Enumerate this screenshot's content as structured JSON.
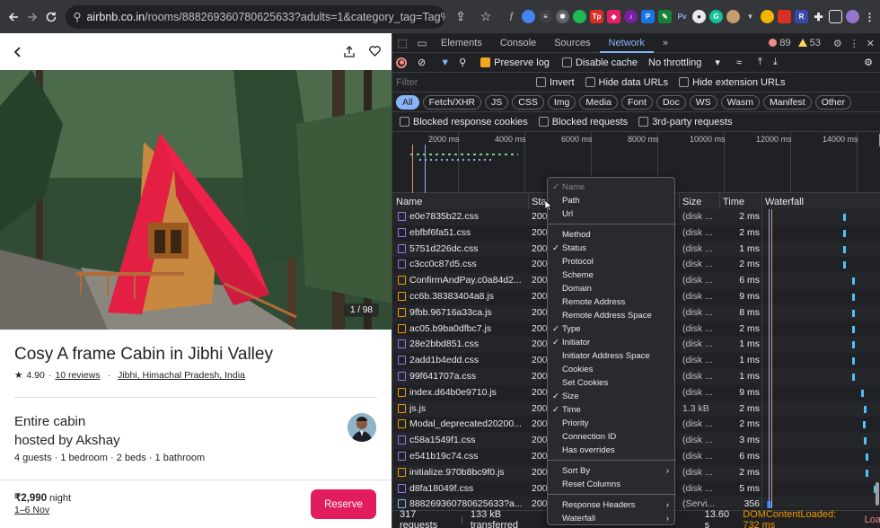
{
  "browser": {
    "url_host": "airbnb.co.in",
    "url_path": "/rooms/888269360780625633?adults=1&category_tag=Tag%3A818..."
  },
  "listing": {
    "photo_counter": "1 / 98",
    "title": "Cosy A frame Cabin in Jibhi Valley",
    "rating": "4.90",
    "reviews": "10 reviews",
    "dot": "·",
    "location": "Jibhi, Himachal Pradesh, India",
    "host_line1": "Entire cabin",
    "host_line2": "hosted by Akshay",
    "facts": "4 guests · 1 bedroom · 2 beds · 1 bathroom",
    "price": "₹2,990",
    "price_unit": "night",
    "dates": "1–6 Nov",
    "reserve_label": "Reserve"
  },
  "devtools": {
    "tabs": [
      "Elements",
      "Console",
      "Sources",
      "Network"
    ],
    "active_tab": "Network",
    "more_tabs": "»",
    "errors": "89",
    "warnings": "53",
    "toolbar": {
      "preserve_log": "Preserve log",
      "disable_cache": "Disable cache",
      "throttling": "No throttling"
    },
    "filter": {
      "placeholder": "Filter",
      "invert": "Invert",
      "hide_data_urls": "Hide data URLs",
      "hide_extension_urls": "Hide extension URLs"
    },
    "type_filters": [
      "All",
      "Fetch/XHR",
      "JS",
      "CSS",
      "Img",
      "Media",
      "Font",
      "Doc",
      "WS",
      "Wasm",
      "Manifest",
      "Other"
    ],
    "blocked": {
      "blocked_cookies": "Blocked response cookies",
      "blocked_requests": "Blocked requests",
      "third_party": "3rd-party requests"
    },
    "timeline_ticks": [
      "2000 ms",
      "4000 ms",
      "6000 ms",
      "8000 ms",
      "10000 ms",
      "12000 ms",
      "14000 ms"
    ],
    "columns": {
      "name": "Name",
      "status": "Sta",
      "size": "Size",
      "time": "Time",
      "waterfall": "Waterfall"
    },
    "rows": [
      {
        "name": "e0e7835b22.css",
        "status": "200",
        "size": "(disk ...",
        "time": "2 ms",
        "type": "css",
        "wf": 0.7
      },
      {
        "name": "ebfbf6fa51.css",
        "status": "200",
        "size": "(disk ...",
        "time": "2 ms",
        "type": "css",
        "wf": 0.7
      },
      {
        "name": "5751d226dc.css",
        "status": "200",
        "size": "(disk ...",
        "time": "1 ms",
        "type": "css",
        "wf": 0.7
      },
      {
        "name": "c3cc0c87d5.css",
        "status": "200",
        "size": "(disk ...",
        "time": "2 ms",
        "type": "css",
        "wf": 0.7
      },
      {
        "name": "ConfirmAndPay.c0a84d2...",
        "status": "200",
        "size": "(disk ...",
        "time": "6 ms",
        "type": "js",
        "wf": 0.78
      },
      {
        "name": "cc6b.38383404a8.js",
        "status": "200",
        "size": "(disk ...",
        "time": "9 ms",
        "type": "js",
        "wf": 0.78
      },
      {
        "name": "9fbb.96716a33ca.js",
        "status": "200",
        "size": "(disk ...",
        "time": "8 ms",
        "type": "js",
        "wf": 0.78
      },
      {
        "name": "ac05.b9ba0dfbc7.js",
        "status": "200",
        "size": "(disk ...",
        "time": "2 ms",
        "type": "js",
        "wf": 0.78
      },
      {
        "name": "28e2bbd851.css",
        "status": "200",
        "size": "(disk ...",
        "time": "1 ms",
        "type": "css",
        "wf": 0.78
      },
      {
        "name": "2add1b4edd.css",
        "status": "200",
        "size": "(disk ...",
        "time": "1 ms",
        "type": "css",
        "wf": 0.78
      },
      {
        "name": "99f641707a.css",
        "status": "200",
        "size": "(disk ...",
        "time": "1 ms",
        "type": "css",
        "wf": 0.78
      },
      {
        "name": "index.d64b0e9710.js",
        "status": "200",
        "size": "(disk ...",
        "time": "9 ms",
        "type": "js",
        "wf": 0.86
      },
      {
        "name": "js.js",
        "status": "200",
        "size": "1.3 kB",
        "time": "2 ms",
        "type": "js",
        "wf": 0.88
      },
      {
        "name": "Modal_deprecated20200...",
        "status": "200",
        "size": "(disk ...",
        "time": "2 ms",
        "type": "js",
        "wf": 0.87
      },
      {
        "name": "c58a1549f1.css",
        "status": "200",
        "size": "(disk ...",
        "time": "3 ms",
        "type": "css",
        "wf": 0.88
      },
      {
        "name": "e541b19c74.css",
        "status": "200",
        "size": "(disk ...",
        "time": "6 ms",
        "type": "css",
        "wf": 0.9
      },
      {
        "name": "initialize.970b8bc9f0.js",
        "status": "200",
        "size": "(disk ...",
        "time": "2 ms",
        "type": "js",
        "wf": 0.9
      },
      {
        "name": "d8fa18049f.css",
        "status": "200",
        "size": "(disk ...",
        "time": "5 ms",
        "type": "css",
        "wf": 0.97
      },
      {
        "name": "888269360780625633?a...",
        "status": "200",
        "size": "(Servi...",
        "time": "356 ms",
        "type": "doc",
        "wf": 0.02
      }
    ],
    "status_bar": {
      "requests": "317 requests",
      "transferred": "133 kB transferred",
      "finish": "13.60 s",
      "dcl": "DOMContentLoaded: 732 ms",
      "load": "Loa"
    },
    "context_menu": [
      {
        "label": "Name",
        "checked": true,
        "disabled": true
      },
      {
        "label": "Path"
      },
      {
        "label": "Url"
      },
      {
        "sep": true
      },
      {
        "label": "Method"
      },
      {
        "label": "Status",
        "checked": true
      },
      {
        "label": "Protocol"
      },
      {
        "label": "Scheme"
      },
      {
        "label": "Domain"
      },
      {
        "label": "Remote Address"
      },
      {
        "label": "Remote Address Space"
      },
      {
        "label": "Type",
        "checked": true
      },
      {
        "label": "Initiator",
        "checked": true
      },
      {
        "label": "Initiator Address Space"
      },
      {
        "label": "Cookies"
      },
      {
        "label": "Set Cookies"
      },
      {
        "label": "Size",
        "checked": true
      },
      {
        "label": "Time",
        "checked": true
      },
      {
        "label": "Priority"
      },
      {
        "label": "Connection ID"
      },
      {
        "label": "Has overrides"
      },
      {
        "sep": true
      },
      {
        "label": "Sort By",
        "submenu": true
      },
      {
        "label": "Reset Columns"
      },
      {
        "sep": true
      },
      {
        "label": "Response Headers",
        "submenu": true
      },
      {
        "label": "Waterfall",
        "submenu": true
      }
    ]
  },
  "colors": {
    "airbnb_accent": "#e31c5f",
    "devtools_bg": "#202124",
    "devtools_active": "#8ab4f8",
    "dcl_blue": "#8ab4f8",
    "load_red": "#f28b82",
    "css_icon": "#a370f7",
    "js_icon": "#f29900",
    "doc_icon": "#8ab4f8"
  }
}
